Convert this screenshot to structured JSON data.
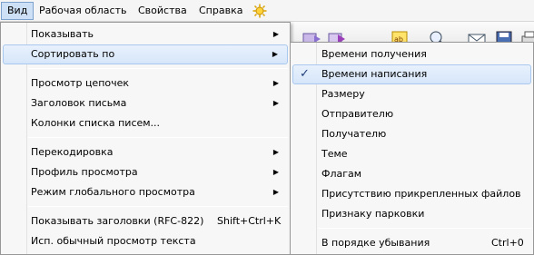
{
  "menubar": {
    "items": [
      "Вид",
      "Рабочая область",
      "Свойства",
      "Справка"
    ],
    "extra_icon": "sun-icon"
  },
  "view_menu": {
    "items": [
      {
        "label": "Показывать",
        "submenu": true
      },
      {
        "label": "Сортировать по",
        "submenu": true
      },
      {
        "label": "Просмотр цепочек",
        "submenu": true
      },
      {
        "label": "Заголовок письма",
        "submenu": true
      },
      {
        "label": "Колонки списка писем...",
        "submenu": false
      },
      {
        "label": "Перекодировка",
        "submenu": true
      },
      {
        "label": "Профиль просмотра",
        "submenu": true
      },
      {
        "label": "Режим глобального просмотра",
        "submenu": true
      },
      {
        "label": "Показывать заголовки (RFC-822)",
        "shortcut": "Shift+Ctrl+K"
      },
      {
        "label": "Исп. обычный просмотр текста"
      }
    ]
  },
  "sort_submenu": {
    "items": [
      {
        "label": "Времени получения"
      },
      {
        "label": "Времени написания",
        "checked": true
      },
      {
        "label": "Размеру"
      },
      {
        "label": "Отправителю"
      },
      {
        "label": "Получателю"
      },
      {
        "label": "Теме"
      },
      {
        "label": "Флагам"
      },
      {
        "label": "Присутствию прикрепленных файлов"
      },
      {
        "label": "Признаку парковки"
      },
      {
        "label": "В порядке убывания",
        "shortcut": "Ctrl+0"
      }
    ],
    "check_glyph": "✓"
  },
  "glyphs": {
    "submenu_arrow": "▶"
  },
  "colors": {
    "highlight": "#d6e6fa",
    "highlight_border": "#a8c8ef",
    "active_menubar": "#cde0f5"
  }
}
